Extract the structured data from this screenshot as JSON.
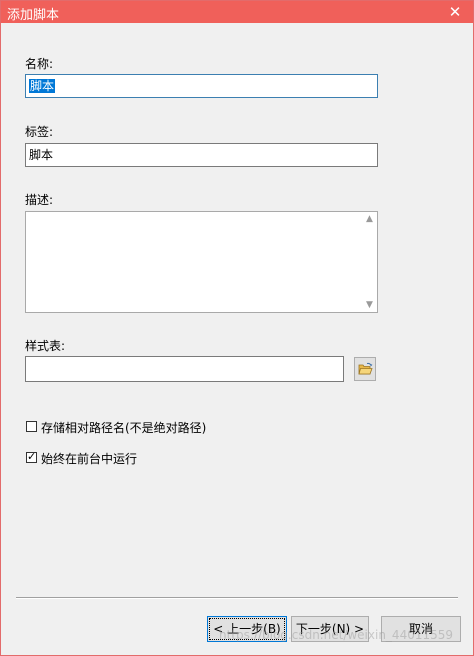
{
  "window": {
    "title": "添加脚本",
    "close_glyph": "✕"
  },
  "fields": {
    "name_label": "名称:",
    "name_value": "脚本",
    "tag_label": "标签:",
    "tag_value": "脚本",
    "description_label": "描述:",
    "description_value": "",
    "stylesheet_label": "样式表:",
    "stylesheet_value": ""
  },
  "icons": {
    "scroll_up": "▲",
    "scroll_down": "▼",
    "folder": "folder-open-icon"
  },
  "options": {
    "relative_path": {
      "label": "存储相对路径名(不是绝对路径)",
      "checked": false
    },
    "always_foreground": {
      "label": "始终在前台中运行",
      "checked": true
    }
  },
  "buttons": {
    "back": "< 上一步(B)",
    "next": "下一步(N) >",
    "cancel": "取消"
  },
  "watermark": "https://blog.csdn.net/weixin_44011559",
  "colors": {
    "titlebar": "#f0605a",
    "focus_border": "#3c7fb1",
    "selection": "#0078d7"
  }
}
